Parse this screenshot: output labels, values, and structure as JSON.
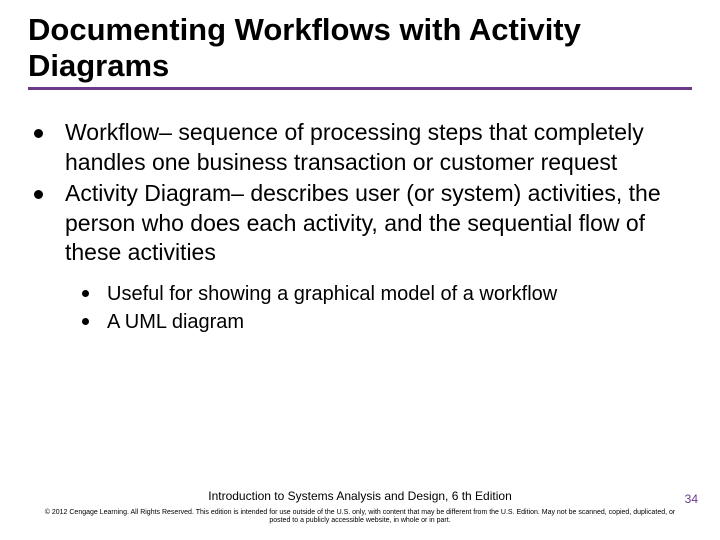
{
  "title": "Documenting Workflows with Activity Diagrams",
  "bullets": [
    "Workflow– sequence of processing steps that completely handles one business transaction or customer request",
    "Activity Diagram– describes user (or system) activities, the person who does each activity, and the sequential flow of these activities"
  ],
  "sub_bullets": [
    "Useful for showing a graphical model of a workflow",
    "A UML diagram"
  ],
  "footer_book": "Introduction to Systems Analysis and Design, 6 th Edition",
  "footer_copy": "© 2012 Cengage Learning. All Rights Reserved. This edition is intended for use outside of the U.S. only, with content that may be different from the U.S. Edition. May not be scanned, copied, duplicated, or posted to a publicly accessible website, in whole or in part.",
  "page_number": "34"
}
